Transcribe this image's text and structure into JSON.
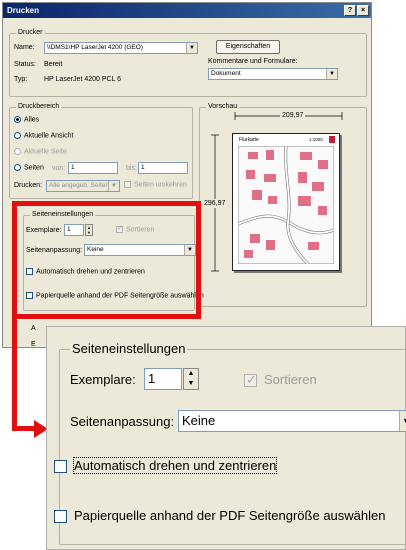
{
  "window": {
    "title": "Drucken",
    "help_button": "?",
    "close_button": "×"
  },
  "printer": {
    "group_label": "Drucker",
    "name_label": "Name:",
    "name_value": "\\\\DMS1\\HP LaserJet 4200 (GEO)",
    "properties_button": "Eigenschaften",
    "status_label": "Status:",
    "status_value": "Bereit",
    "type_label": "Typ:",
    "type_value": "HP LaserJet 4200 PCL 6",
    "comments_label": "Kommentare und Formulare:",
    "comments_value": "Dokument"
  },
  "print_range": {
    "group_label": "Druckbereich",
    "all": "Alles",
    "current_view": "Aktuelle Ansicht",
    "current_page": "Aktuelle Seite",
    "pages": "Seiten",
    "from_label": "von:",
    "from_value": "1",
    "to_label": "bis:",
    "to_value": "1",
    "print_label": "Drucken:",
    "print_value": "Alle angegeb. Seiten",
    "reverse_pages": "Seiten umkehren"
  },
  "preview": {
    "group_label": "Vorschau",
    "width_value": "209,97",
    "height_value": "296,97",
    "map_title": "Flurkarte",
    "map_scale_text": "1:1000"
  },
  "page_settings": {
    "group_label": "Seiteneinstellungen",
    "copies_label": "Exemplare:",
    "copies_value": "1",
    "collate_label": "Sortieren",
    "scaling_label": "Seitenanpassung:",
    "scaling_value": "Keine",
    "auto_rotate_label": "Automatisch drehen und zentrieren",
    "paper_source_label": "Papierquelle anhand der PDF Seitengröße auswählen"
  },
  "cut_labels": {
    "a_stub": "A",
    "e_stub": "E"
  },
  "accent_colors": {
    "highlight_red": "#e01010",
    "title_bar": "#0a246a",
    "dialog_bg": "#ece9d8"
  }
}
